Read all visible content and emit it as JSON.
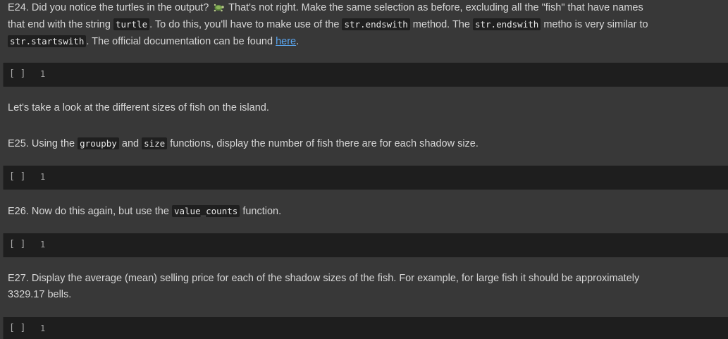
{
  "cells": {
    "e24": {
      "part1": "E24. Did you notice the turtles in the output?",
      "part2": "That's not right. Make the same selection as before, excluding all the \"fish\" that have names that end with the string",
      "code1": "turtle",
      "part3": ". To do this, you'll have to make use of the",
      "code2": "str.endswith",
      "part4": "method. The",
      "code3": "str.endswith",
      "part5": "metho is very similar to",
      "code4": "str.startswith",
      "part6": ". The official documentation can be found",
      "link": "here",
      "part7": "."
    },
    "code1": {
      "prompt": "[ ]",
      "line": "1"
    },
    "sizes_intro": "Let's take a look at the different sizes of fish on the island.",
    "e25": {
      "part1": "E25. Using the",
      "code1": "groupby",
      "part2": "and",
      "code2": "size",
      "part3": "functions, display the number of fish there are for each shadow size."
    },
    "code2": {
      "prompt": "[ ]",
      "line": "1"
    },
    "e26": {
      "part1": "E26. Now do this again, but use the",
      "code1": "value_counts",
      "part2": "function."
    },
    "code3": {
      "prompt": "[ ]",
      "line": "1"
    },
    "e27": {
      "text": "E27. Display the average (mean) selling price for each of the shadow sizes of the fish. For example, for large fish it should be approximately 3329.17 bells."
    },
    "code4": {
      "prompt": "[ ]",
      "line": "1"
    }
  },
  "icons": {
    "turtle": "turtle-icon"
  },
  "colors": {
    "background": "#383838",
    "code_cell": "#1e1e1e",
    "link": "#5aa6f0"
  }
}
